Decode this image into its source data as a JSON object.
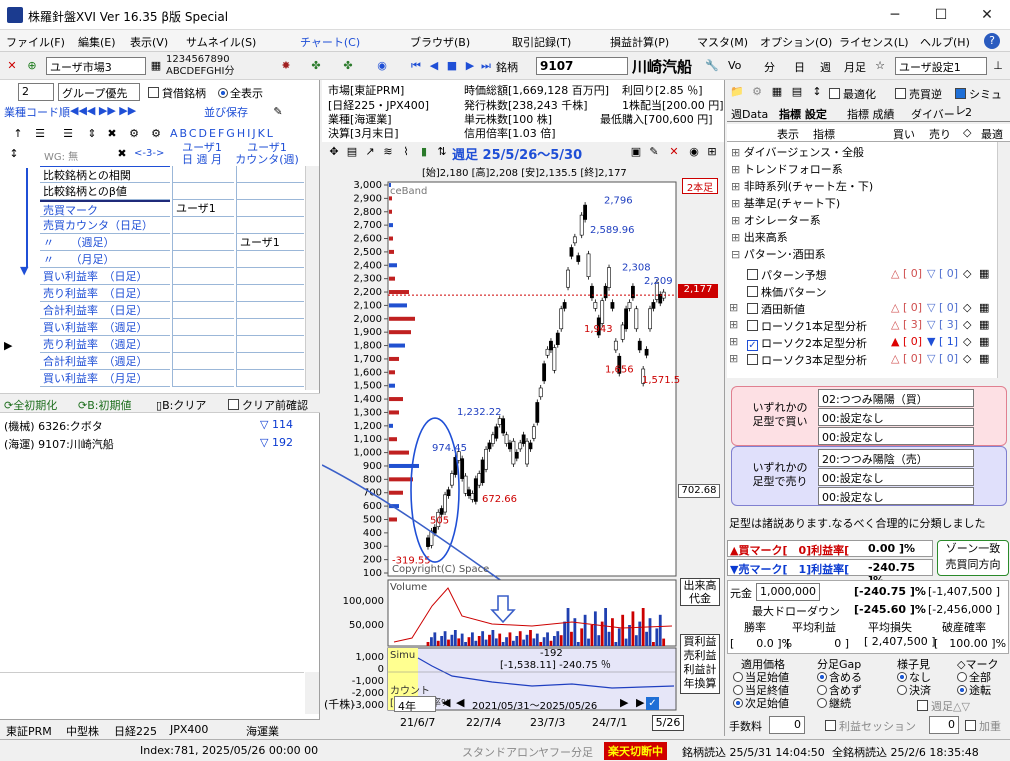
{
  "window": {
    "title": "株羅針盤XVI Ver 16.35 β版  Special",
    "minimize": "─",
    "maximize": "☐",
    "close": "✕"
  },
  "menu": [
    "ファイル(F)",
    "編集(E)",
    "表示(V)",
    "サムネイル(S)",
    "チャート(C)",
    "ブラウザ(B)",
    "取引記録(T)",
    "損益計算(P)",
    "マスタ(M)",
    "オプション(O)",
    "ライセンス(L)",
    "ヘルプ(H)"
  ],
  "toolbar1": {
    "market_select": "ユーザ市場3",
    "numbers_row1": "1234567890",
    "letters_row2": "ABCDEFGHI分",
    "symbol_label": "銘柄",
    "symbol_code": "9107",
    "symbol_name": "川崎汽船",
    "vo": "Vo",
    "bun": "分",
    "hi": "日",
    "shu": "週",
    "tsuki": "月足",
    "user_setting": "ユーザ設定1"
  },
  "left": {
    "group_num": "2",
    "group_sort": "グループ優先",
    "chk_kashaku": "貸借銘柄",
    "radio_all": "全表示",
    "sort_label": "業種コード順",
    "save_label": "並び保存",
    "col_letters": "ABCDEFGHIJKL",
    "wg_label": "WG: 無",
    "arrows": "<-3->",
    "col_headers": [
      "ユーザ1",
      "ユーザ1"
    ],
    "col_sub": [
      "日 週 月",
      "カウンタ(週)"
    ],
    "rows": [
      {
        "label": "比較銘柄との相関",
        "c1": "",
        "c2": ""
      },
      {
        "label": "比較銘柄とのβ値",
        "c1": "",
        "c2": ""
      },
      {
        "label": "売買マーク",
        "c1": "ユーザ1",
        "c2": ""
      },
      {
        "label": "売買カウンタ（日足）",
        "c1": "",
        "c2": ""
      },
      {
        "label": "〃　　（週足）",
        "c1": "",
        "c2": "ユーザ1"
      },
      {
        "label": "〃　　（月足）",
        "c1": "",
        "c2": ""
      },
      {
        "label": "買い利益率　（日足）",
        "c1": "",
        "c2": ""
      },
      {
        "label": "売り利益率　（日足）",
        "c1": "",
        "c2": ""
      },
      {
        "label": "合計利益率　（日足）",
        "c1": "",
        "c2": ""
      },
      {
        "label": "買い利益率　（週足）",
        "c1": "",
        "c2": ""
      },
      {
        "label": "売り利益率　（週足）",
        "c1": "",
        "c2": ""
      },
      {
        "label": "合計利益率　（週足）",
        "c1": "",
        "c2": ""
      },
      {
        "label": "買い利益率　（月足）",
        "c1": "",
        "c2": ""
      }
    ],
    "btn_reset_all": "全初期化",
    "btn_b_reset": "B:初期値",
    "btn_b_clear": "B:クリア",
    "chk_clear_confirm": "クリア前確認",
    "stocks": [
      {
        "name": "(機械) 6326:クボタ",
        "val": "▽ 114"
      },
      {
        "name": "(海運) 9107:川崎汽船",
        "val": "▽ 192"
      }
    ],
    "status_cells": [
      "東証PRM",
      "中型株",
      "日経225",
      "JPX400",
      "海運業"
    ]
  },
  "info": {
    "market": "市場[東証PRM]",
    "index": "[日経225・JPX400]",
    "industry": "業種[海運業]",
    "settle": "決算[3月末日]",
    "mcap": "時価総額[1,669,128 百万円]",
    "shares": "発行株数[238,243 千株]",
    "unit": "単元株数[100 株]",
    "credit": "信用倍率[1.03 倍]",
    "yield": "利回り[2.85 ％]",
    "div": "1株配当[200.00 円]",
    "minbuy": "最低購入[700,600 円]"
  },
  "chart": {
    "week_title": "週足 25/5/26～5/30",
    "ohlc": "[始]2,180 [高]2,208 [安]2,135.5 [終]2,177",
    "tag_2bar": "2本足",
    "price_tag": "2,177",
    "band_label": "ceBand",
    "yticks": [
      "3,000",
      "2,900",
      "2,800",
      "2,700",
      "2,600",
      "2,500",
      "2,400",
      "2,300",
      "2,200",
      "2,100",
      "2,000",
      "1,900",
      "1,800",
      "1,700",
      "1,600",
      "1,500",
      "1,400",
      "1,300",
      "1,200",
      "1,100",
      "1,000",
      "900",
      "800",
      "700",
      "600",
      "500",
      "400",
      "300",
      "200",
      "100"
    ],
    "annotations": [
      {
        "t": "2,796",
        "c": "blue"
      },
      {
        "t": "2,589.96",
        "c": "blue"
      },
      {
        "t": "2,308",
        "c": "blue"
      },
      {
        "t": "2,209",
        "c": "blue"
      },
      {
        "t": "1,943",
        "c": "red"
      },
      {
        "t": "1,656",
        "c": "red"
      },
      {
        "t": "1,571.5",
        "c": "red"
      },
      {
        "t": "1,232.22",
        "c": "blue"
      },
      {
        "t": "974.45",
        "c": "blue"
      },
      {
        "t": "672.66",
        "c": "red"
      },
      {
        "t": "505",
        "c": "red"
      },
      {
        "t": "-319.55",
        "c": "red"
      },
      {
        "t": "702.68",
        "c": "black"
      }
    ],
    "copyright": "Copyright(C) Space",
    "volume_label": "Volume",
    "vol_ticks": [
      "100,000",
      "50,000"
    ],
    "sim_label": "Simu",
    "sim_ticks": [
      "1,000",
      "0",
      "-1,000",
      "-2,000",
      "-3,000"
    ],
    "sim_value": "-192",
    "sim_detail": "[-1,538.11] -240.75 ％",
    "count_label": "カウント",
    "profit_label": "[利益額] 率%",
    "side_buttons": [
      "出来高",
      "代金",
      "買利益",
      "売利益",
      "利益計",
      "年換算"
    ],
    "unit": "(千株)",
    "period_select": "4年",
    "range": "2021/05/31～2025/05/26",
    "x_ticks": [
      "21/6/7",
      "22/7/4",
      "23/7/3",
      "24/7/1"
    ],
    "last_date": "5/26"
  },
  "right": {
    "tabs": [
      "週Data",
      "指標",
      "設定",
      "指標",
      "成績",
      "ダイバー",
      "2"
    ],
    "chk_optimize": "最適化",
    "chk_reverse": "売買逆",
    "chk_sim": "シミュレ",
    "cols": [
      "表示",
      "指標",
      "買い",
      "売り",
      "◇",
      "最適"
    ],
    "tree": [
      {
        "t": "ダイバージェンス・全般",
        "lvl": 0
      },
      {
        "t": "トレンドフォロー系",
        "lvl": 0
      },
      {
        "t": "非時系列(チャート左・下)",
        "lvl": 0
      },
      {
        "t": "基準足(チャート下)",
        "lvl": 0
      },
      {
        "t": "オシレーター系",
        "lvl": 0
      },
      {
        "t": "出来高系",
        "lvl": 0
      },
      {
        "t": "パターン･酒田系",
        "lvl": 0
      }
    ],
    "subtree": [
      {
        "t": "パターン予想",
        "buy": "[ 0]",
        "sell": "[ 0]",
        "checked": false
      },
      {
        "t": "株価パターン",
        "buy": "",
        "sell": "",
        "checked": false
      },
      {
        "t": "酒田新値",
        "buy": "[ 0]",
        "sell": "[ 0]",
        "checked": false
      },
      {
        "t": "ローソク1本足型分析",
        "buy": "[ 3]",
        "sell": "[ 3]",
        "checked": false
      },
      {
        "t": "ローソク2本足型分析",
        "buy": "[ 0]",
        "sell": "[ 1]",
        "checked": true
      },
      {
        "t": "ローソク3本足型分析",
        "buy": "[ 0]",
        "sell": "[ 0]",
        "checked": false
      }
    ],
    "buy_box_label": "いずれかの\n足型で買い",
    "buy_opts": [
      "02:つつみ陽陽（買）",
      "00:設定なし",
      "00:設定なし"
    ],
    "sell_box_label": "いずれかの\n足型で売り",
    "sell_opts": [
      "20:つつみ陽陰（売）",
      "00:設定なし",
      "00:設定なし"
    ],
    "note": "足型は諸説あります.なるべく合理的に分類しました",
    "buy_mark": "▲買マーク[　0]利益率[",
    "buy_pct": "0.00 ]%",
    "sell_mark": "▼売マーク[　1]利益率[",
    "sell_pct": "-240.75 ]%",
    "zone_btn": "ゾーン一致",
    "same_dir_btn": "売買同方向",
    "capital_label": "元金",
    "capital": "1,000,000",
    "cap_pct": "[-240.75 ]%",
    "cap_amt": "[-1,407,500 ]",
    "dd_label": "最大ドローダウン",
    "dd_pct": "[-245.60 ]%",
    "dd_amt": "[-2,456,000 ]",
    "win_label": "勝率",
    "avg_profit_label": "平均利益",
    "avg_loss_label": "平均損失",
    "bust_label": "破産確率",
    "win_val": "[　　0.0 ]%",
    "avg_profit_val": "[　　　　0 ]",
    "avg_loss_val": "[ 2,407,500 ]",
    "bust_val": "[　100.00 ]%",
    "price_title": "適用価格",
    "gap_title": "分足Gap",
    "view_title": "様子見",
    "mark_title": "◇マーク",
    "price_opts": [
      "当足始値",
      "当足終値",
      "次足始値"
    ],
    "gap_opts": [
      "含める",
      "含めず",
      "継続"
    ],
    "view_opts": [
      "なし",
      "決済"
    ],
    "mark_opts": [
      "全部",
      "途転"
    ],
    "chk_weekly": "週足△▽",
    "fee_label": "手数料",
    "fee_val": "0",
    "chk_session": "利益セッション",
    "session_val": "0",
    "chk_add": "加重"
  },
  "status": {
    "index": "Index:781, 2025/05/26 00:00 00",
    "standalone": "スタンドアロン",
    "yahoo": "ヤフー分足",
    "rakuten": "楽天切断中",
    "read1": "銘柄読込 25/5/31 14:04:50",
    "read2": "全銘柄読込 25/2/6 18:35:48"
  },
  "colors": {
    "accent_blue": "#1f4fd6",
    "red": "#c00000",
    "chart_bg": "#ffffff",
    "sim_bg": "#e8e8f8",
    "yellow": "#ffff80"
  }
}
